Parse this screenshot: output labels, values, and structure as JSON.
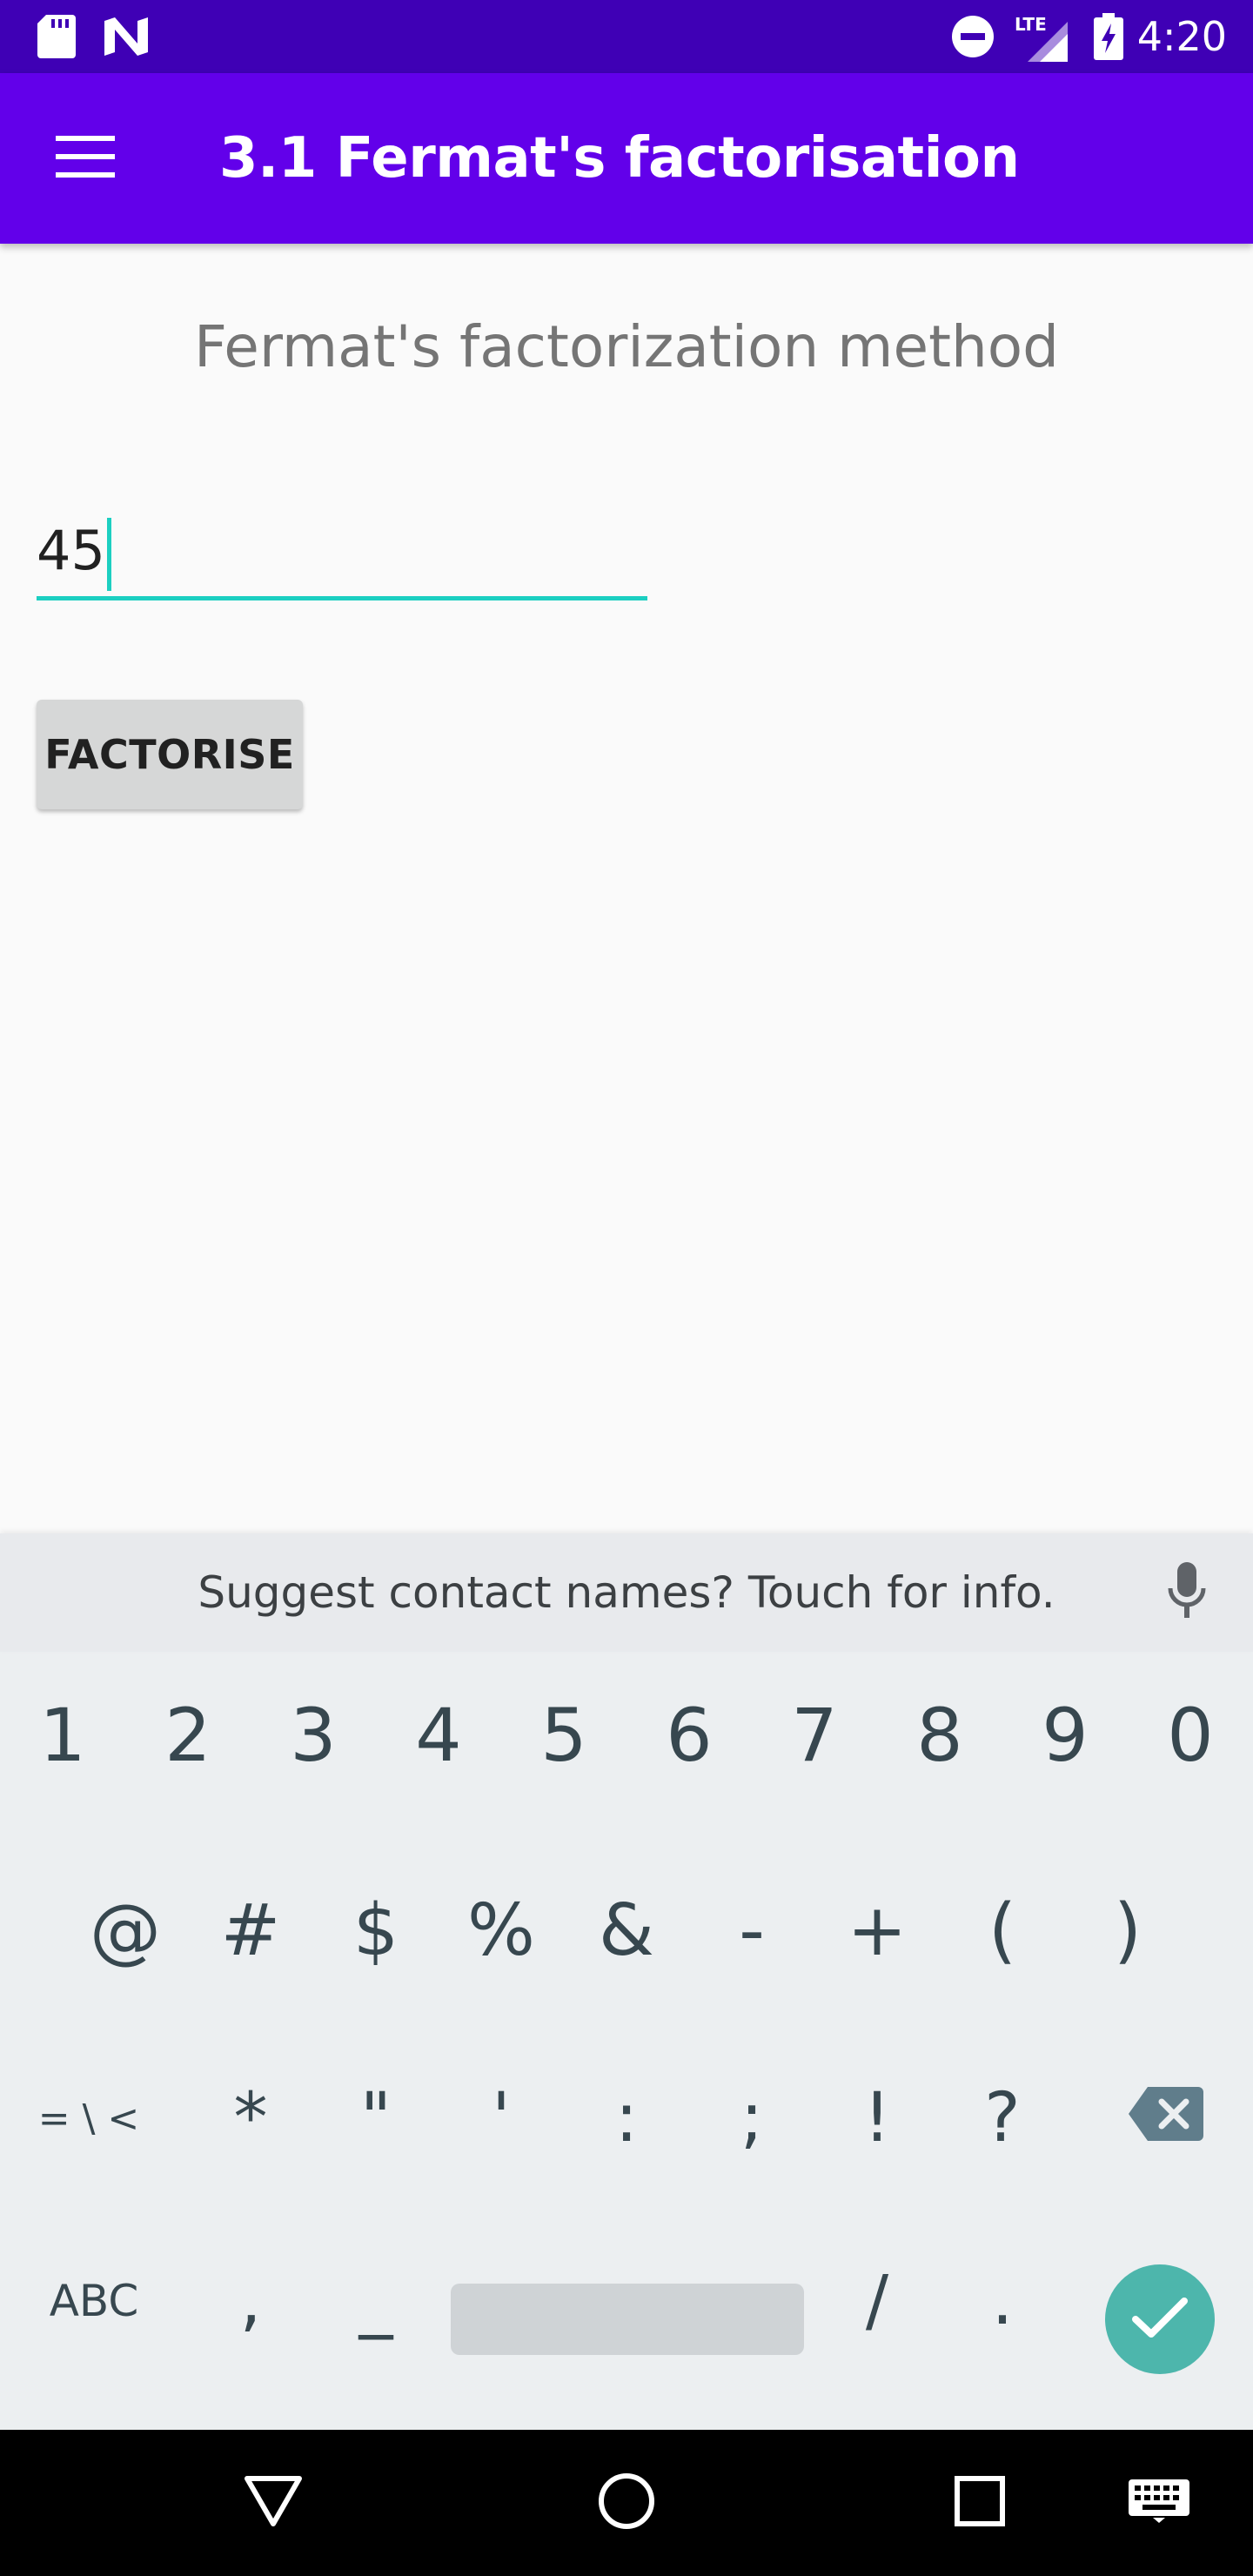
{
  "status_bar": {
    "time": "4:20",
    "network_label": "LTE",
    "icons": [
      "sd-card-icon",
      "n-logo-icon",
      "do-not-disturb-icon",
      "signal-icon",
      "battery-charging-icon"
    ]
  },
  "app_bar": {
    "title": "3.1 Fermat's factorisation",
    "menu_icon": "hamburger-menu-icon",
    "color": "#6200ea"
  },
  "main": {
    "heading": "Fermat's factorization method",
    "number_input": {
      "value": "45"
    },
    "factorise_button": "FACTORISE"
  },
  "keyboard": {
    "suggestion": "Suggest contact names? Touch for info.",
    "row1": [
      "1",
      "2",
      "3",
      "4",
      "5",
      "6",
      "7",
      "8",
      "9",
      "0"
    ],
    "row2": [
      "@",
      "#",
      "$",
      "%",
      "&",
      "-",
      "+",
      "(",
      ")"
    ],
    "row3": [
      "= \\ <",
      "*",
      "\"",
      "'",
      ":",
      ";",
      "!",
      "?"
    ],
    "row4": {
      "abc": "ABC",
      "comma": ",",
      "underscore": "_",
      "slash": "/",
      "period": "."
    },
    "accent_color": "#4db6ac"
  },
  "nav_bar": {
    "icons": [
      "back-icon",
      "home-icon",
      "recents-icon",
      "keyboard-switch-icon"
    ]
  }
}
